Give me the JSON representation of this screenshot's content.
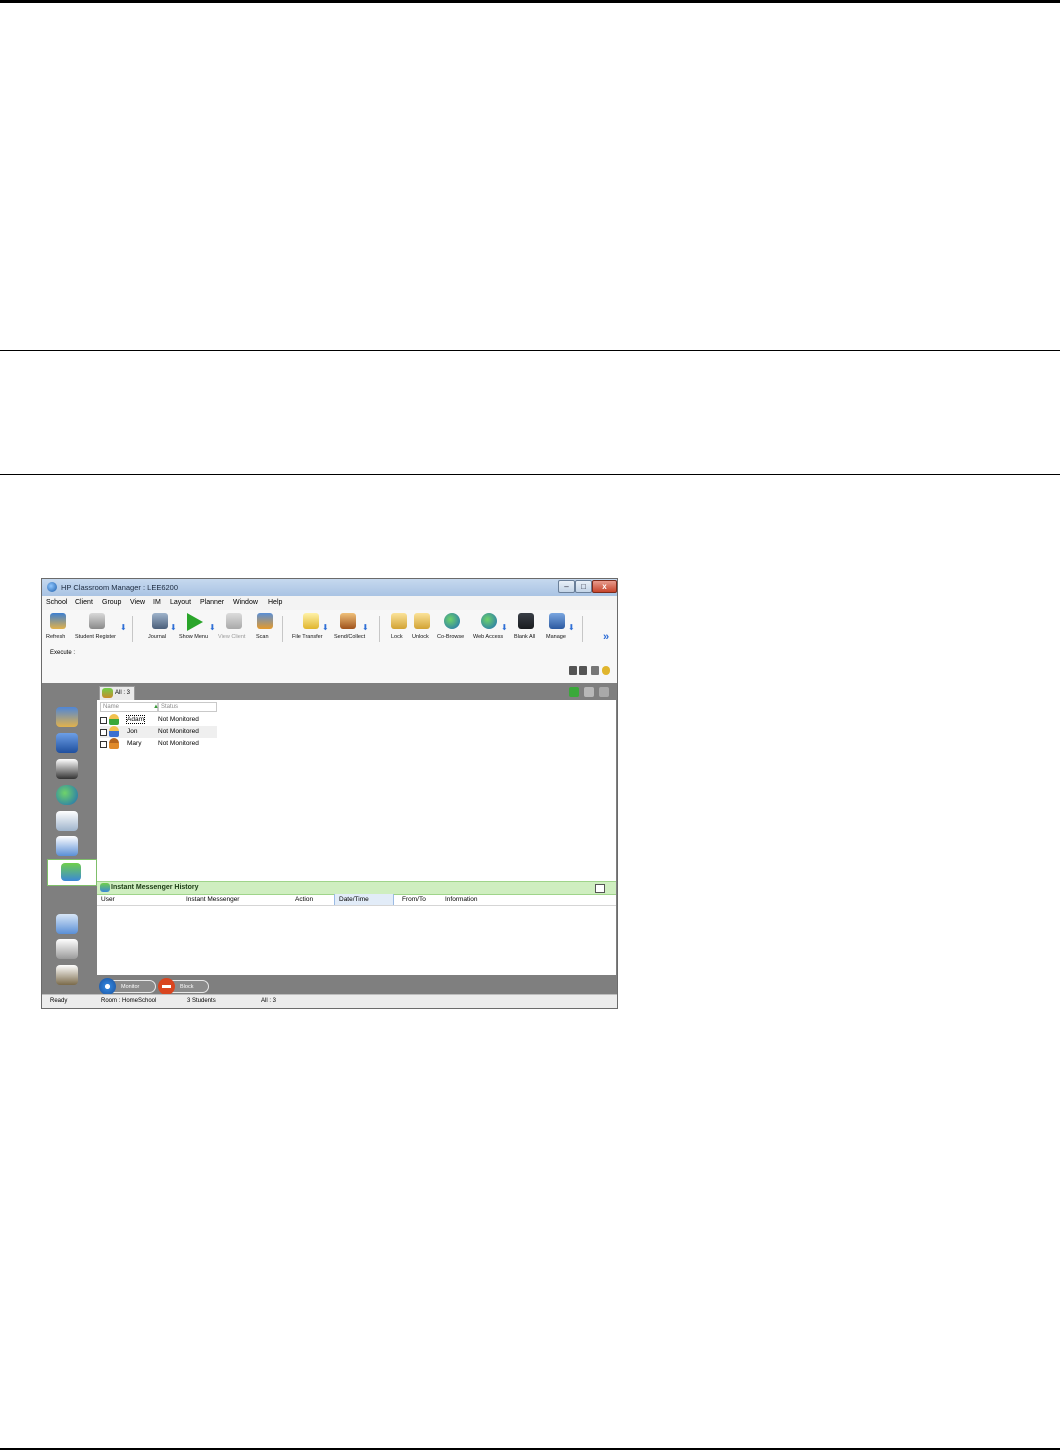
{
  "window": {
    "title": "HP Classroom Manager : LEE6200",
    "controls": [
      "minimize",
      "maximize",
      "close"
    ]
  },
  "menu": [
    "School",
    "Client",
    "Group",
    "View",
    "IM",
    "Layout",
    "Planner",
    "Window",
    "Help"
  ],
  "toolbar": {
    "items": [
      {
        "label": "Refresh",
        "icon": "refresh-icon"
      },
      {
        "label": "Student Register",
        "icon": "student-register-icon"
      },
      {
        "label": "Journal",
        "icon": "journal-icon"
      },
      {
        "label": "Show Menu",
        "icon": "show-menu-icon"
      },
      {
        "label": "View Client",
        "icon": "view-client-icon",
        "disabled": true
      },
      {
        "label": "Scan",
        "icon": "scan-icon"
      },
      {
        "label": "File Transfer",
        "icon": "file-transfer-icon"
      },
      {
        "label": "Send/Collect",
        "icon": "send-collect-icon"
      },
      {
        "label": "Lock",
        "icon": "lock-icon"
      },
      {
        "label": "Unlock",
        "icon": "unlock-icon"
      },
      {
        "label": "Co-Browse",
        "icon": "co-browse-icon"
      },
      {
        "label": "Web Access",
        "icon": "web-access-icon"
      },
      {
        "label": "Blank All",
        "icon": "blank-all-icon"
      },
      {
        "label": "Manage",
        "icon": "manage-icon"
      }
    ]
  },
  "execute": {
    "label": "Execute :"
  },
  "tab": {
    "label": "All : 3"
  },
  "student_list": {
    "columns": [
      "Name",
      "Status"
    ],
    "rows": [
      {
        "name": "Adam",
        "status": "Not Monitored"
      },
      {
        "name": "Jon",
        "status": "Not Monitored"
      },
      {
        "name": "Mary",
        "status": "Not Monitored"
      }
    ]
  },
  "im_history": {
    "title": "Instant Messenger History",
    "columns": [
      "User",
      "Instant Messenger",
      "Action",
      "Date/Time",
      "From/To",
      "Information"
    ]
  },
  "actions": {
    "monitor": "Monitor",
    "block": "Block"
  },
  "statusbar": {
    "ready": "Ready",
    "room": "Room : HomeSchool",
    "students": "3 Students",
    "all": "All : 3"
  },
  "colors": {
    "frame": "#7f7f7f",
    "im_header": "#cfeec0",
    "titlebar": "#b9cfe9",
    "close": "#c6452c"
  }
}
